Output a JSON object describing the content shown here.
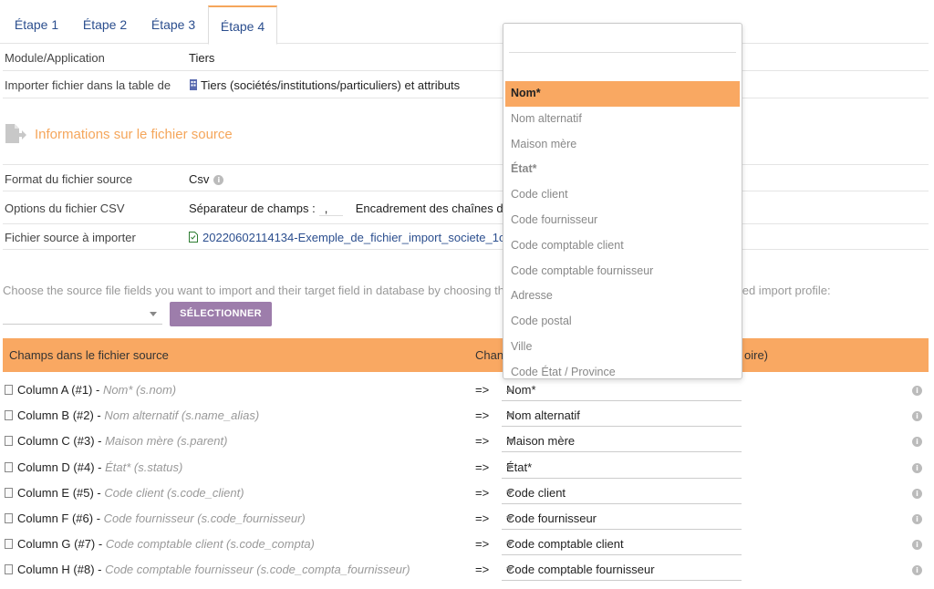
{
  "tabs": [
    "Étape 1",
    "Étape 2",
    "Étape 3",
    "Étape 4"
  ],
  "module": {
    "label": "Module/Application",
    "value": "Tiers"
  },
  "import_table": {
    "label": "Importer fichier dans la table de",
    "value": "Tiers (sociétés/institutions/particuliers) et attributs"
  },
  "source_section": {
    "title": "Informations sur le fichier source"
  },
  "format": {
    "label": "Format du fichier source",
    "value": "Csv"
  },
  "csv_options": {
    "label": "Options du fichier CSV",
    "separator_label": "Séparateur de champs :",
    "separator_value": ",",
    "enclosure_label": "Encadrement des chaînes d"
  },
  "source_file": {
    "label": "Fichier source à importer",
    "value": "20220602114134-Exemple_de_fichier_import_societe_1c"
  },
  "choose": {
    "text": "Choose the source file fields you want to import and their target field in database by choosing th",
    "tail": "fined import profile:"
  },
  "select_button": "SÉLECTIONNER",
  "table_header": {
    "source": "Champs dans le fichier source",
    "target": "Chan",
    "target_tail": "oire)"
  },
  "mappings": [
    {
      "col": "Column A (#1) - ",
      "hint": "Nom* (s.nom)",
      "target": "Nom*"
    },
    {
      "col": "Column B (#2) - ",
      "hint": "Nom alternatif (s.name_alias)",
      "target": "Nom alternatif"
    },
    {
      "col": "Column C (#3) - ",
      "hint": "Maison mère (s.parent)",
      "target": "Maison mère"
    },
    {
      "col": "Column D (#4) - ",
      "hint": "État* (s.status)",
      "target": "État*"
    },
    {
      "col": "Column E (#5) - ",
      "hint": "Code client (s.code_client)",
      "target": "Code client"
    },
    {
      "col": "Column F (#6) - ",
      "hint": "Code fournisseur (s.code_fournisseur)",
      "target": "Code fournisseur"
    },
    {
      "col": "Column G (#7) - ",
      "hint": "Code comptable client (s.code_compta)",
      "target": "Code comptable client"
    },
    {
      "col": "Column H (#8) - ",
      "hint": "Code comptable fournisseur (s.code_compta_fournisseur)",
      "target": "Code comptable fournisseur"
    }
  ],
  "arrow": "=>",
  "dropdown_options": [
    "Nom*",
    "Nom alternatif",
    "Maison mère",
    "État*",
    "Code client",
    "Code fournisseur",
    "Code comptable client",
    "Code comptable fournisseur",
    "Adresse",
    "Code postal",
    "Ville",
    "Code État / Province"
  ],
  "colors": {
    "accent": "#f9a862",
    "button": "#9d7dab",
    "link": "#2b4e8e"
  }
}
